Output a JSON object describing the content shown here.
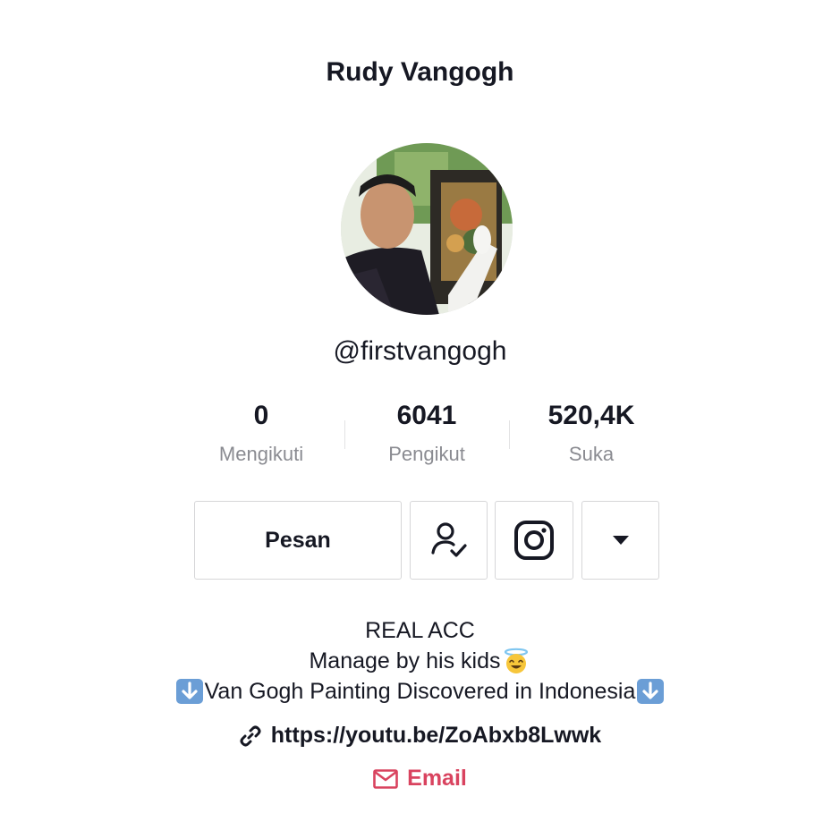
{
  "profile": {
    "display_name": "Rudy Vangogh",
    "handle": "@firstvangogh"
  },
  "stats": [
    {
      "value": "0",
      "label": "Mengikuti"
    },
    {
      "value": "6041",
      "label": "Pengikut"
    },
    {
      "value": "520,4K",
      "label": "Suka"
    }
  ],
  "actions": {
    "message_label": "Pesan",
    "following_icon": "person-check-icon",
    "instagram_icon": "instagram-icon",
    "more_icon": "caret-down-icon"
  },
  "bio": {
    "line1": "REAL ACC",
    "line2": "Manage by his kids",
    "line2_emoji": "smiling-face-with-halo",
    "line3": "Van Gogh Painting Discovered in Indonesia",
    "line3_emoji": "down-arrow-button"
  },
  "link": {
    "icon": "link-icon",
    "url": "https://youtu.be/ZoAbxb8Lwwk"
  },
  "email": {
    "icon": "mail-icon",
    "label": "Email"
  },
  "colors": {
    "text": "#161823",
    "muted": "#8a8b91",
    "border": "#d6d6d8",
    "email_accent": "#d9435f",
    "emoji_blue": "#6b9ed6"
  }
}
